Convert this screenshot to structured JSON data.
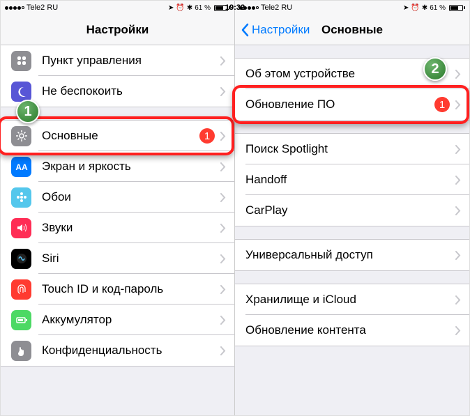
{
  "status": {
    "carrier": "Tele2 RU",
    "time": "19:32",
    "battery": "61 %"
  },
  "left": {
    "title": "Настройки",
    "rows": [
      {
        "label": "Пункт управления",
        "icon": "control",
        "c": "#8e8e93"
      },
      {
        "label": "Не беспокоить",
        "icon": "moon",
        "c": "#5856d6"
      },
      {
        "label": "Основные",
        "icon": "gear",
        "c": "#8e8e93",
        "badge": "1",
        "hl": true
      },
      {
        "label": "Экран и яркость",
        "icon": "aa",
        "c": "#007aff"
      },
      {
        "label": "Обои",
        "icon": "flower",
        "c": "#54c7ec"
      },
      {
        "label": "Звуки",
        "icon": "speaker",
        "c": "#ff2d55"
      },
      {
        "label": "Siri",
        "icon": "siri",
        "c": "#000"
      },
      {
        "label": "Touch ID и код-пароль",
        "icon": "finger",
        "c": "#ff3b30"
      },
      {
        "label": "Аккумулятор",
        "icon": "battery",
        "c": "#4cd964"
      },
      {
        "label": "Конфиденциальность",
        "icon": "hand",
        "c": "#8e8e93"
      }
    ]
  },
  "right": {
    "back": "Настройки",
    "title": "Основные",
    "groups": [
      [
        {
          "label": "Об этом устройстве"
        },
        {
          "label": "Обновление ПО",
          "badge": "1",
          "hl": true
        }
      ],
      [
        {
          "label": "Поиск Spotlight"
        },
        {
          "label": "Handoff"
        },
        {
          "label": "CarPlay"
        }
      ],
      [
        {
          "label": "Универсальный доступ"
        }
      ],
      [
        {
          "label": "Хранилище и iCloud"
        },
        {
          "label": "Обновление контента"
        }
      ]
    ]
  },
  "markers": {
    "m1": "1",
    "m2": "2"
  }
}
